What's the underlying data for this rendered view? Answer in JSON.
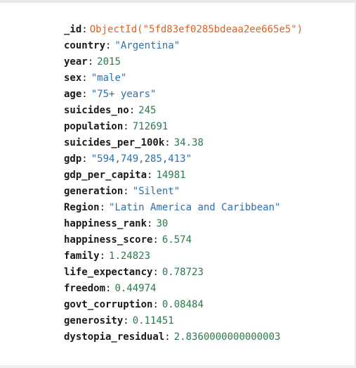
{
  "document": {
    "fields": [
      {
        "key": "_id",
        "value": "ObjectId(\"5fd83ef0285bdeaa2ee665e5\")",
        "type": "objectid"
      },
      {
        "key": "country",
        "value": "\"Argentina\"",
        "type": "string"
      },
      {
        "key": "year",
        "value": "2015",
        "type": "number"
      },
      {
        "key": "sex",
        "value": "\"male\"",
        "type": "string"
      },
      {
        "key": "age",
        "value": "\"75+ years\"",
        "type": "string"
      },
      {
        "key": "suicides_no",
        "value": "245",
        "type": "number"
      },
      {
        "key": "population",
        "value": "712691",
        "type": "number"
      },
      {
        "key": "suicides_per_100k",
        "value": "34.38",
        "type": "number"
      },
      {
        "key": "gdp",
        "value": "\"594,749,285,413\"",
        "type": "string"
      },
      {
        "key": "gdp_per_capita",
        "value": "14981",
        "type": "number"
      },
      {
        "key": "generation",
        "value": "\"Silent\"",
        "type": "string"
      },
      {
        "key": "Region",
        "value": "\"Latin America and Caribbean\"",
        "type": "string"
      },
      {
        "key": "happiness_rank",
        "value": "30",
        "type": "number"
      },
      {
        "key": "happiness_score",
        "value": "6.574",
        "type": "number"
      },
      {
        "key": "family",
        "value": "1.24823",
        "type": "number"
      },
      {
        "key": "life_expectancy",
        "value": "0.78723",
        "type": "number"
      },
      {
        "key": "freedom",
        "value": "0.44974",
        "type": "number"
      },
      {
        "key": "govt_corruption",
        "value": "0.08484",
        "type": "number"
      },
      {
        "key": "generosity",
        "value": "0.11451",
        "type": "number"
      },
      {
        "key": "dystopia_residual",
        "value": "2.8360000000000003",
        "type": "number"
      }
    ],
    "colors": {
      "key": "#1a1a1a",
      "objectid": "#e06020",
      "string": "#2b6fb0",
      "number": "#2a7a4b"
    }
  }
}
